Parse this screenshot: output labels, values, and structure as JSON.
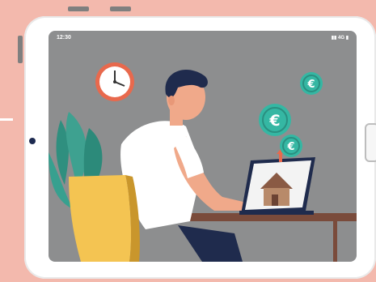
{
  "status_bar": {
    "time": "12:30",
    "signal": "4G"
  },
  "colors": {
    "background": "#f3b9ad",
    "screen": "#8d8e8f",
    "coin": "#35b7a3",
    "shirt": "#ffffff",
    "chair": "#f4c452"
  },
  "illustration": {
    "coin_symbol": "€"
  }
}
